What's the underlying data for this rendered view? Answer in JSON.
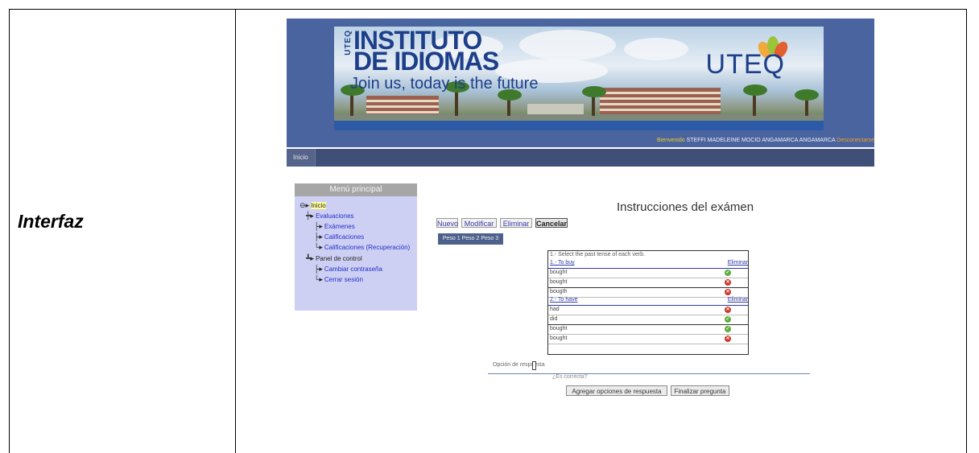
{
  "document": {
    "row_label": "Interfaz"
  },
  "site": {
    "brand": {
      "vertical": "UTEQ",
      "title_line1": "INSTITUTO",
      "title_line2": "DE IDIOMAS",
      "slogan": "Join us, today is the future",
      "logo": "UTEQ"
    },
    "welcome": {
      "prefix": "Bienvenido",
      "user": "STEFFI MADELEINE MOCIO ANGAMARCA ANGAMARCA",
      "logout": "Desconectarse"
    },
    "nav": {
      "home": "Inicio"
    }
  },
  "menu": {
    "title": "Menú principal",
    "root": "Inicio",
    "items": [
      {
        "label": "Evaluaciones",
        "level": 1
      },
      {
        "label": "Exámenes",
        "level": 2
      },
      {
        "label": "Calificaciones",
        "level": 2
      },
      {
        "label": "Calificaciones (Recuperación)",
        "level": 2
      },
      {
        "label": "Panel de control",
        "level": 1
      },
      {
        "label": "Cambiar contraseña",
        "level": 2
      },
      {
        "label": "Cerrar sesión",
        "level": 2
      }
    ]
  },
  "content": {
    "title": "Instrucciones del exámen",
    "buttons": {
      "new": "Nuevo",
      "modify": "Modificar",
      "delete": "Eliminar",
      "cancel": "Cancelar"
    },
    "peso_tabs": "Peso 1 Peso 2 Peso 3",
    "instruction": "1.- Select the past tense of each verb.",
    "questions": [
      {
        "title": "1.- To buy",
        "delete": "Eliminar",
        "options": [
          {
            "text": "bought",
            "status": "ok"
          },
          {
            "text": "bought",
            "status": "bad"
          },
          {
            "text": "bougth",
            "status": "bad"
          }
        ]
      },
      {
        "title": "2.- To have",
        "delete": "Eliminar",
        "options": [
          {
            "text": "had",
            "status": "bad"
          },
          {
            "text": "did",
            "status": "ok"
          },
          {
            "text": "bought",
            "status": "ok"
          },
          {
            "text": "bought",
            "status": "bad"
          }
        ]
      }
    ],
    "answer_label": "Opción de respuesta",
    "correct_label": "¿Es correcta?",
    "add_options_button": "Agregar opciones de respuesta",
    "finish_button": "Finalizar pregunta"
  }
}
